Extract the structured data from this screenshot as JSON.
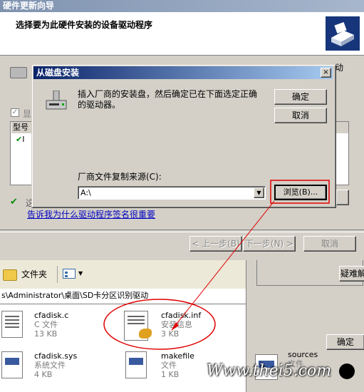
{
  "wizard": {
    "title": "硬件更新向导",
    "heading": "选择要为此硬件安装的设备驱动程序",
    "right_fragment": "动",
    "checkbox_label": "显",
    "list_header": "型号",
    "list_item_fragment": "I",
    "signed_fragment": "这",
    "link": "告诉我为什么驱动程序签名很重要",
    "back_button": "< 上一步(B)",
    "next_button": "下一步(N) >",
    "cancel_button": "取消"
  },
  "dialog": {
    "title": "从磁盘安装",
    "close_glyph": "×",
    "message": "插入厂商的安装盘，然后确定已在下面选定正确的驱动器。",
    "ok_button": "确定",
    "cancel_button": "取消",
    "source_label": "厂商文件复制来源(C):",
    "source_value": "A:\\",
    "browse_button": "浏览(B)...",
    "dropdown_glyph": "▼"
  },
  "explorer": {
    "folders_label": "文件夹",
    "address": "s\\Administrator\\桌面\\SD卡分区识别驱动",
    "files": [
      {
        "name": "cfadisk.c",
        "type": "C 文件",
        "size": "13 KB"
      },
      {
        "name": "cfadisk.inf",
        "type": "安装信息",
        "size": "3 KB"
      },
      {
        "name": "cfadisk.sys",
        "type": "系统文件",
        "size": "4 KB"
      },
      {
        "name": "makefile",
        "type": "文件",
        "size": "1 KB"
      },
      {
        "name": "sources",
        "type": "文件",
        "size": "1 KB"
      }
    ]
  },
  "right_panel": {
    "troubleshoot_button": "疑难解",
    "ok_button": "确定"
  },
  "watermark": "Www.thei5.com",
  "colors": {
    "title_active": "#0a246a",
    "annotation_red": "#e00000",
    "face": "#d4d0c8"
  }
}
